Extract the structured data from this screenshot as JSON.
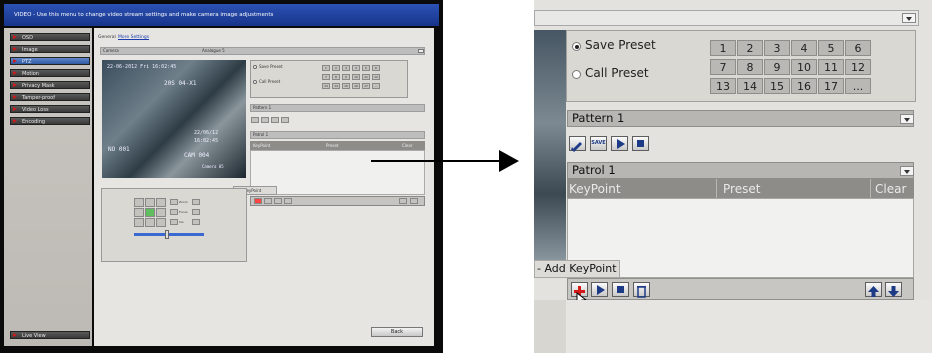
{
  "left": {
    "header_text": "VIDEO - Use this menu to change video stream settings and make camera image adjustments",
    "sidebar": [
      {
        "label": "OSD",
        "selected": false
      },
      {
        "label": "Image",
        "selected": false
      },
      {
        "label": "PTZ",
        "selected": true
      },
      {
        "label": "Motion",
        "selected": false
      },
      {
        "label": "Privacy Mask",
        "selected": false
      },
      {
        "label": "Tamper-proof",
        "selected": false
      },
      {
        "label": "Video Loss",
        "selected": false
      },
      {
        "label": "Encoding",
        "selected": false
      }
    ],
    "live_view": "Live View",
    "tabs": [
      "General",
      "More Settings"
    ],
    "camera_label": "Camera",
    "camera_value": "Analogue 5",
    "save_preset": "Save Preset",
    "call_preset": "Call Preset",
    "preset_numbers": [
      "1",
      "2",
      "3",
      "4",
      "5",
      "6",
      "7",
      "8",
      "9",
      "10",
      "11",
      "12",
      "13",
      "14",
      "15",
      "16",
      "17",
      "..."
    ],
    "pattern": "Pattern 1",
    "patrol": "Patrol 1",
    "patrol_cols": [
      "KeyPoint",
      "Preset",
      "Clear"
    ],
    "add_keypoint": "Add KeyPoint",
    "back": "Back",
    "video": {
      "datetime": "22-06-2012 Fri 16:02:45",
      "overlay_a": "20S  04-X1",
      "overlay_b": "NO 001",
      "overlay_c": "CAM 004",
      "overlay_d": "Camera 05",
      "overlay_e": "22/06/12",
      "overlay_f": "16:02:45"
    },
    "zoom_labels": [
      "Zoom",
      "Focus",
      "Iris"
    ]
  },
  "right": {
    "save_preset": "Save Preset",
    "call_preset": "Call Preset",
    "preset_numbers": [
      "1",
      "2",
      "3",
      "4",
      "5",
      "6",
      "7",
      "8",
      "9",
      "10",
      "11",
      "12",
      "13",
      "14",
      "15",
      "16",
      "17",
      "..."
    ],
    "pattern": "Pattern 1",
    "save_btn": "SAVE",
    "patrol": "Patrol 1",
    "patrol_cols": [
      "KeyPoint",
      "Preset",
      "Clear"
    ],
    "add_keypoint": "- Add KeyPoint"
  }
}
